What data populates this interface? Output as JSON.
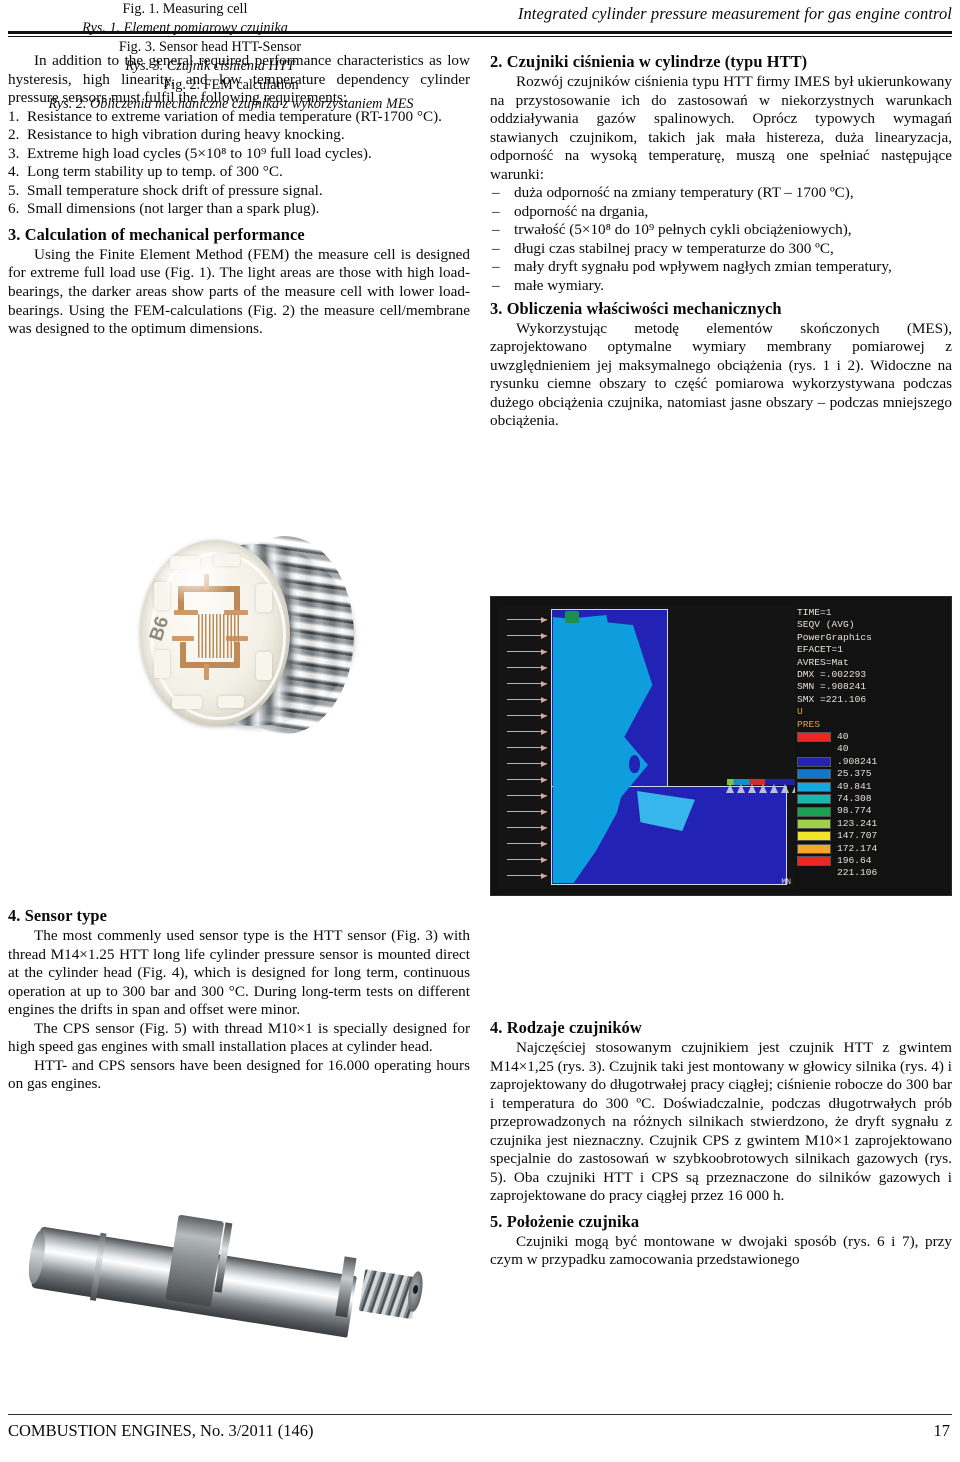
{
  "running_head": "Integrated cylinder pressure measurement for gas engine control",
  "left_column": {
    "intro": "In addition to the general required performance characteristics as low hysteresis, high linearity, and low temperature dependency cylinder pressure sensors must fulfil the following requirements:",
    "requirements": [
      {
        "num": "1.",
        "text": "Resistance to extreme variation of media temperature (RT-1700 °C)."
      },
      {
        "num": "2.",
        "text": "Resistance to high vibration during heavy knocking."
      },
      {
        "num": "3.",
        "text": "Extreme high load cycles (5×10⁸ to 10⁹ full load cycles)."
      },
      {
        "num": "4.",
        "text": "Long term stability up to temp. of 300 °C."
      },
      {
        "num": "5.",
        "text": "Small temperature shock drift of pressure signal."
      },
      {
        "num": "6.",
        "text": "Small dimensions (not larger than a spark plug)."
      }
    ],
    "section3_heading": "3. Calculation of mechanical performance",
    "section3_body": "Using the Finite Element Method (FEM) the measure cell is designed for extreme full load use (Fig. 1). The light areas are those with high load-bearings, the darker areas show parts of the measure cell with lower load-bearings. Using the FEM-calculations (Fig. 2) the measure cell/membrane was designed to the optimum dimensions.",
    "section4_heading": "4. Sensor type",
    "section4_p1": "The most commenly used sensor type is the HTT sensor (Fig. 3) with thread M14×1.25 HTT long life cylinder pressure sensor is mounted direct at the cylinder head (Fig. 4), which is designed for long term, continuous operation at up to 300 bar and 300 °C. During long-term tests on different engines the drifts in span and offset were minor.",
    "section4_p2": "The CPS sensor (Fig. 5) with thread M10×1 is specially designed for high speed gas engines with small installation places at cylinder head.",
    "section4_p3": "HTT- and CPS sensors have been designed for 16.000 operating hours on gas engines."
  },
  "right_column": {
    "section2_heading": "2. Czujniki ciśnienia w cylindrze (typu HTT)",
    "section2_body": "Rozwój czujników ciśnienia typu HTT firmy IMES był ukierunkowany na przystosowanie ich do zastosowań w niekorzystnych warunkach oddziaływania gazów spalinowych. Oprócz typowych wymagań stawianych czujnikom, takich jak mała histereza, duża linearyzacja, odporność na wysoką temperaturę, muszą one spełniać następujące warunki:",
    "bullets": [
      "duża odporność na zmiany temperatury (RT – 1700 ºC),",
      "odporność na drgania,",
      "trwałość (5×10⁸ do 10⁹ pełnych cykli obciążeniowych),",
      "długi czas stabilnej pracy w temperaturze do 300 ºC,",
      "mały dryft sygnału pod wpływem nagłych zmian temperatury,",
      "małe wymiary."
    ],
    "section3_heading": "3. Obliczenia właściwości mechanicznych",
    "section3_body": "Wykorzystując metodę elementów skończonych (MES), zaprojektowano optymalne wymiary membrany pomiarowej z uwzględnieniem jej maksymalnego obciążenia (rys. 1 i 2). Widoczne na rysunku ciemne obszary to część pomiarowa wykorzystywana podczas dużego obciążenia czujnika, natomiast jasne obszary – podczas mniejszego obciążenia.",
    "section4_heading": "4. Rodzaje czujników",
    "section4_body": "Najczęściej stosowanym czujnikiem jest czujnik HTT z gwintem M14×1,25 (rys. 3). Czujnik taki jest montowany w głowicy silnika (rys. 4) i zaprojektowany do długotrwałej pracy ciągłej; ciśnienie robocze do 300 bar i temperatura do 300 ºC. Doświadczalnie, podczas długotrwałych prób przeprowadzonych na różnych silnikach stwierdzono, że dryft sygnału z czujnika jest nieznaczny. Czujnik CPS z gwintem M10×1 zaprojektowano specjalnie do zastosowań w szybkoobrotowych silnikach gazowych (rys. 5). Oba czujniki HTT i CPS są przeznaczone do silników gazowych i zaprojektowane do pracy ciągłej przez 16 000 h.",
    "section5_heading": "5. Położenie czujnika",
    "section5_body": "Czujniki mogą być montowane w dwojaki sposób (rys. 6 i 7), przy czym w przypadku zamocowania przedstawionego"
  },
  "figures": {
    "fig1": {
      "caption_en": "Fig. 1. Measuring cell",
      "caption_pl": "Rys. 1. Element pomiarowy czujnika",
      "marking": "B6"
    },
    "fig2": {
      "caption_en": "Fig. 2. FEM calculation",
      "caption_pl": "Rys. 2. Obliczenia mechaniczne czujnika z wykorzystaniem MES",
      "legend_header": [
        "TIME=1",
        "SEQV        (AVG)",
        "PowerGraphics",
        "EFACET=1",
        "AVRES=Mat",
        "DMX =.002293",
        "SMN =.908241",
        "SMX =221.106"
      ],
      "legend_labels": [
        "U",
        "PRES"
      ],
      "min_node_label": "MN",
      "scale": [
        {
          "color": "#ef2424",
          "value": "40"
        },
        {
          "color": "",
          "value": "40"
        },
        {
          "color": "#2222b4",
          "value": ".908241"
        },
        {
          "color": "#1577c8",
          "value": "25.375"
        },
        {
          "color": "#19a7e4",
          "value": "49.841"
        },
        {
          "color": "#17b7ad",
          "value": "74.308"
        },
        {
          "color": "#19a050",
          "value": "98.774"
        },
        {
          "color": "#9ed04a",
          "value": "123.241"
        },
        {
          "color": "#f2e42a",
          "value": "147.707"
        },
        {
          "color": "#f5a72a",
          "value": "172.174"
        },
        {
          "color": "#ef2424",
          "value": "196.64"
        },
        {
          "color": "",
          "value": "221.106"
        }
      ]
    },
    "fig3": {
      "caption_en": "Fig. 3. Sensor head HTT-Sensor",
      "caption_pl": "Rys. 3. Czujnik ciśnienia HTT"
    }
  },
  "footer": {
    "journal": "COMBUSTION ENGINES, No. 3/2011 (146)",
    "page": "17"
  }
}
